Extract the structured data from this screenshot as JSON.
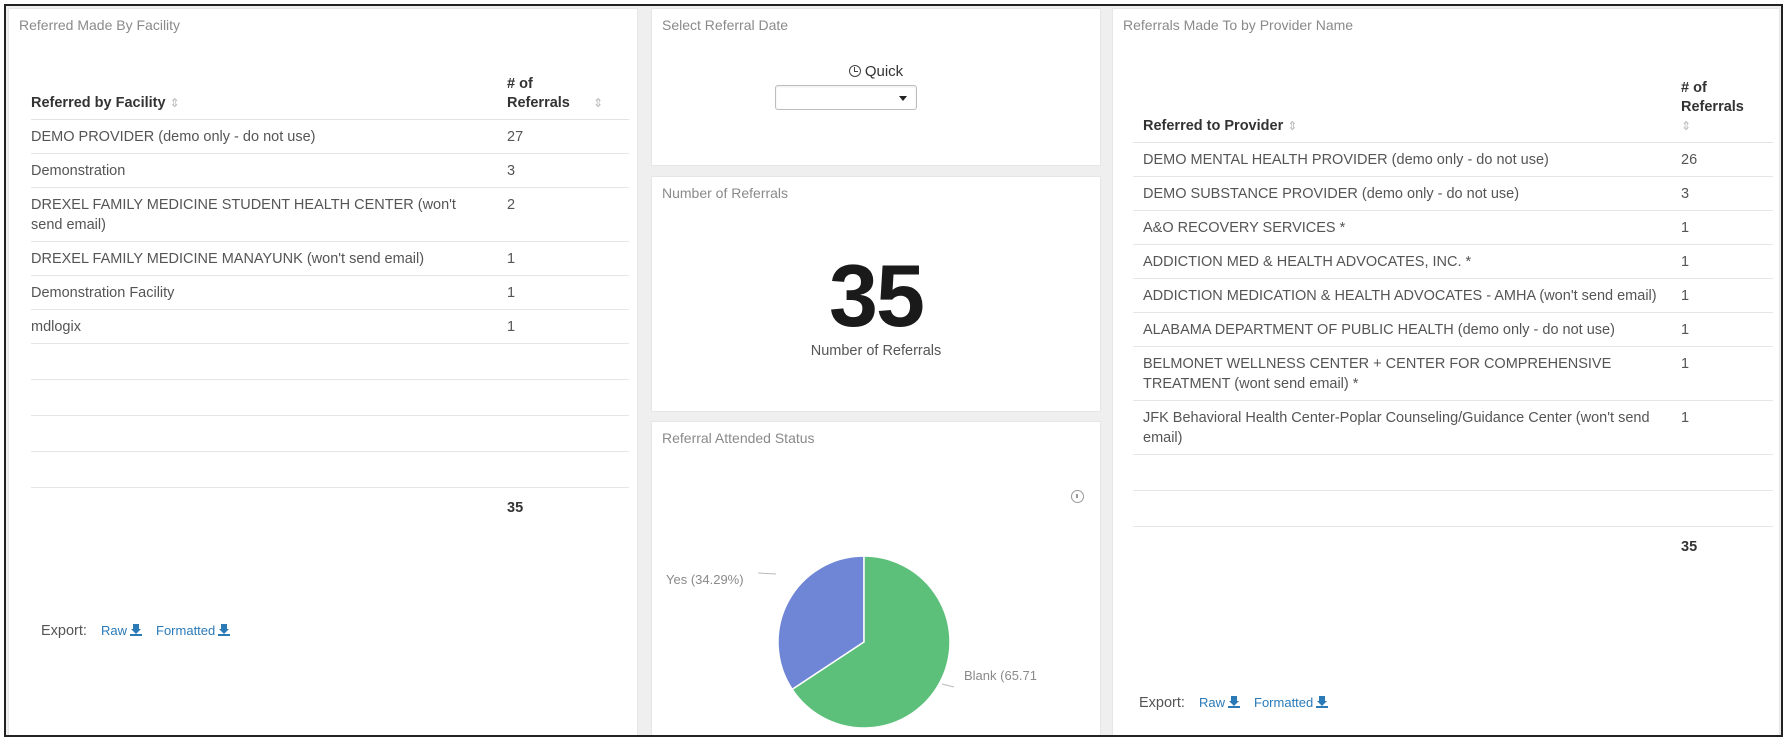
{
  "facility_panel": {
    "title": "Referred Made By Facility",
    "col_name": "Referred by Facility",
    "col_count": "# of Referrals",
    "rows": [
      {
        "name": "DEMO PROVIDER (demo only - do not use)",
        "count": "27"
      },
      {
        "name": "Demonstration",
        "count": "3"
      },
      {
        "name": "DREXEL FAMILY MEDICINE STUDENT HEALTH CENTER (won't send email)",
        "count": "2"
      },
      {
        "name": "DREXEL FAMILY MEDICINE MANAYUNK (won't send email)",
        "count": "1"
      },
      {
        "name": "Demonstration Facility",
        "count": "1"
      },
      {
        "name": "mdlogix",
        "count": "1"
      }
    ],
    "total": "35",
    "export_label": "Export:",
    "raw_label": "Raw",
    "formatted_label": "Formatted"
  },
  "date_panel": {
    "title": "Select Referral Date",
    "quick_label": "Quick",
    "select_value": ""
  },
  "count_panel": {
    "title": "Number of Referrals",
    "value": "35",
    "label": "Number of Referrals"
  },
  "status_panel": {
    "title": "Referral Attended Status",
    "chart_data": {
      "type": "pie",
      "slices": [
        {
          "label": "Yes (34.29%)",
          "value": 34.29,
          "color": "#6f86d6"
        },
        {
          "label": "Blank (65.71",
          "value": 65.71,
          "color": "#5cbf7a"
        }
      ]
    }
  },
  "provider_panel": {
    "title": "Referrals Made To by Provider Name",
    "col_name": "Referred to Provider",
    "col_count": "# of Referrals",
    "rows": [
      {
        "name": "DEMO MENTAL HEALTH PROVIDER (demo only - do not use)",
        "count": "26"
      },
      {
        "name": "DEMO SUBSTANCE PROVIDER (demo only - do not use)",
        "count": "3"
      },
      {
        "name": "A&O RECOVERY SERVICES *",
        "count": "1"
      },
      {
        "name": "ADDICTION MED & HEALTH ADVOCATES, INC. *",
        "count": "1"
      },
      {
        "name": "ADDICTION MEDICATION & HEALTH ADVOCATES - AMHA (won't send email)",
        "count": "1"
      },
      {
        "name": "ALABAMA DEPARTMENT OF PUBLIC HEALTH (demo only - do not use)",
        "count": "1"
      },
      {
        "name": "BELMONET WELLNESS CENTER + CENTER FOR COMPREHENSIVE TREATMENT (wont send email) *",
        "count": "1"
      },
      {
        "name": "JFK Behavioral Health Center-Poplar Counseling/Guidance Center (won't send email)",
        "count": "1"
      }
    ],
    "total": "35",
    "export_label": "Export:",
    "raw_label": "Raw",
    "formatted_label": "Formatted"
  }
}
